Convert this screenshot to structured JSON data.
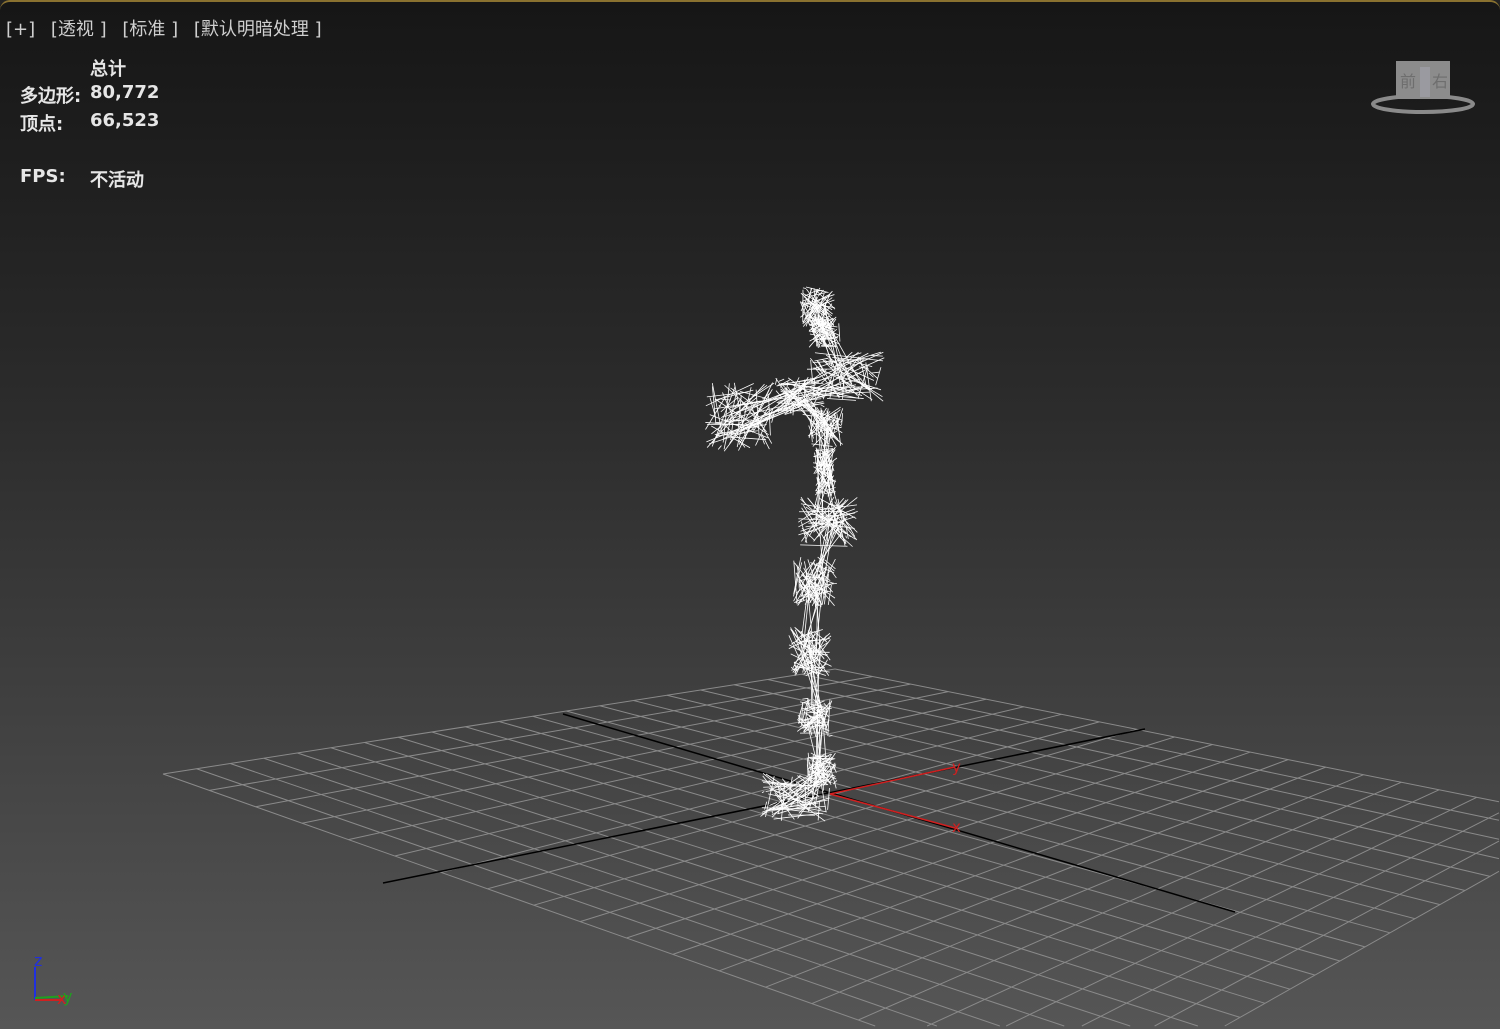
{
  "viewport_menu": {
    "plus": "[+]",
    "view": "[透视 ]",
    "mode": "[标准 ]",
    "shading": "[默认明暗处理 ]"
  },
  "stats": {
    "header": "总计",
    "polygons_label": "多边形:",
    "polygons": "80,772",
    "vertices_label": "顶点:",
    "vertices": "66,523",
    "fps_label": "FPS:",
    "fps": "不活动"
  },
  "viewcube": {
    "left_face": "前",
    "right_face": "右"
  },
  "gizmo": {
    "x": "x",
    "y": "y"
  },
  "axis_tripod": {
    "x": "x",
    "y": "y",
    "z": "z"
  },
  "colors": {
    "x_axis": "#d02020",
    "y_axis": "#20a020",
    "z_axis": "#2030e0",
    "grid": "#8a8a8a",
    "wire": "#ffffff"
  }
}
